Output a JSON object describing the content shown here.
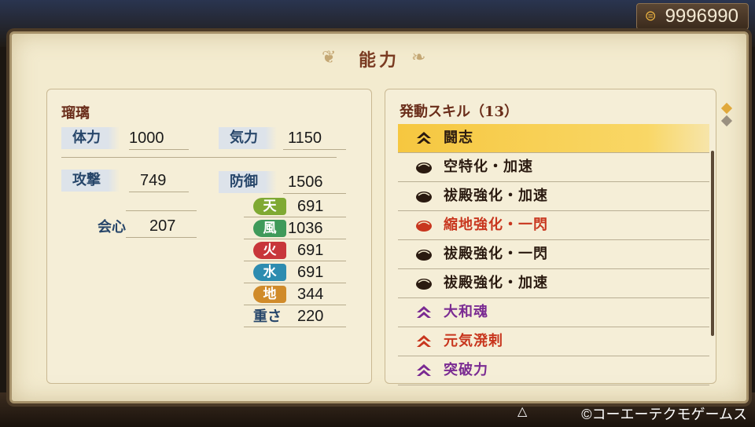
{
  "currency": {
    "icon": "coin-icon",
    "amount": "9996990"
  },
  "title": "能力",
  "character": {
    "name": "瑠璃"
  },
  "stats": {
    "hp_label": "体力",
    "hp": "1000",
    "ki_label": "気力",
    "ki": "1150",
    "atk_label": "攻撃",
    "atk": "749",
    "def_label": "防御",
    "def": "1506",
    "crit_label": "会心",
    "crit": "207",
    "weight_label": "重さ",
    "weight": "220"
  },
  "elements": [
    {
      "label": "天",
      "value": "691",
      "color": "#7fa933"
    },
    {
      "label": "風",
      "value": "1036",
      "color": "#3f9a5a"
    },
    {
      "label": "火",
      "value": "691",
      "color": "#c8363a"
    },
    {
      "label": "水",
      "value": "691",
      "color": "#2d8cb0"
    },
    {
      "label": "地",
      "value": "344",
      "color": "#d08b2a"
    }
  ],
  "skills": {
    "header": "発動スキル（13）",
    "items": [
      {
        "name": "闘志",
        "icon": "chevron-up-icon",
        "color": "#2a1a10",
        "selected": true
      },
      {
        "name": "空特化・加速",
        "icon": "soul-orb-icon",
        "color": "#2a1a10"
      },
      {
        "name": "祓殿強化・加速",
        "icon": "soul-orb-icon",
        "color": "#2a1a10"
      },
      {
        "name": "縮地強化・一閃",
        "icon": "soul-orb-icon",
        "color": "#c8361e"
      },
      {
        "name": "祓殿強化・一閃",
        "icon": "soul-orb-icon",
        "color": "#2a1a10"
      },
      {
        "name": "祓殿強化・加速",
        "icon": "soul-orb-icon",
        "color": "#2a1a10"
      },
      {
        "name": "大和魂",
        "icon": "chevron-up-icon",
        "color": "#7a2a92"
      },
      {
        "name": "元気溌剌",
        "icon": "chevron-up-icon",
        "color": "#c8361e"
      },
      {
        "name": "突破力",
        "icon": "chevron-up-icon",
        "color": "#7a2a92"
      }
    ]
  },
  "footer": {
    "triangle_button": "△",
    "copyright": "©コーエーテクモゲームス"
  }
}
